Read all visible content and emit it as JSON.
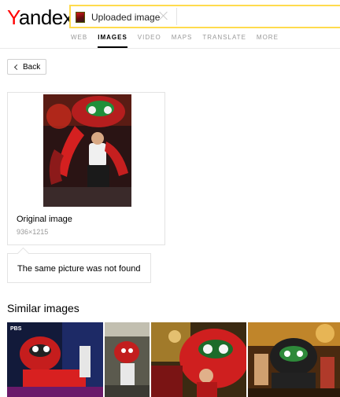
{
  "logo": {
    "text_first": "Y",
    "text_rest": "andex"
  },
  "search": {
    "chip_label": "Uploaded image"
  },
  "nav": {
    "items": [
      {
        "label": "WEB",
        "active": false
      },
      {
        "label": "IMAGES",
        "active": true
      },
      {
        "label": "VIDEO",
        "active": false
      },
      {
        "label": "MAPS",
        "active": false
      },
      {
        "label": "TRANSLATE",
        "active": false
      },
      {
        "label": "MORE",
        "active": false
      }
    ]
  },
  "back": {
    "label": "Back"
  },
  "original": {
    "label": "Original image",
    "dimensions": "936×1215"
  },
  "notice": {
    "text": "The same picture was not found"
  },
  "similar": {
    "title": "Similar images",
    "watermark": "PBS"
  },
  "colors": {
    "logo_red": "#ff0000",
    "search_border": "#ffdb4d",
    "accent": "#000000"
  }
}
